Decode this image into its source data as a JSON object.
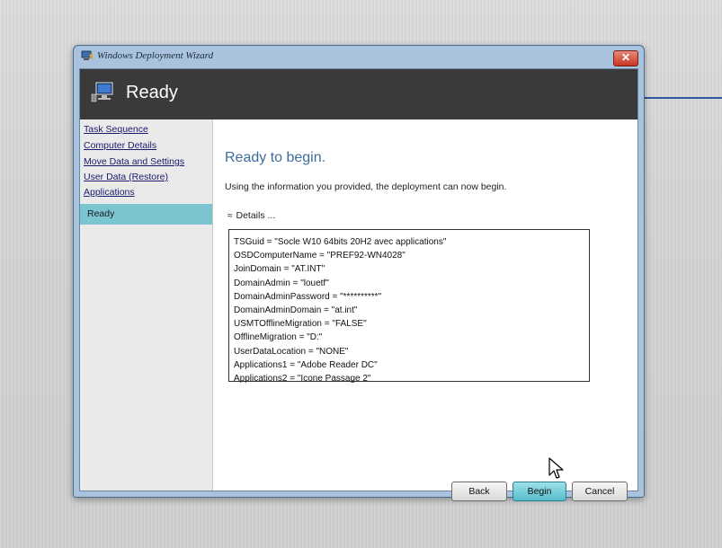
{
  "window": {
    "title": "Windows Deployment Wizard",
    "close_symbol": "✕"
  },
  "header": {
    "title": "Ready",
    "icon": "computer-icon"
  },
  "nav": {
    "items": [
      {
        "label": "Task Sequence",
        "active": false
      },
      {
        "label": "Computer Details",
        "active": false
      },
      {
        "label": "Move Data and Settings",
        "active": false
      },
      {
        "label": "User Data (Restore)",
        "active": false
      },
      {
        "label": "Applications",
        "active": false
      },
      {
        "label": "Ready",
        "active": true
      }
    ]
  },
  "main": {
    "title": "Ready to begin.",
    "description": "Using the information you provided, the deployment can now begin.",
    "details_label": "Details ...",
    "details_chevron": "≈",
    "details": [
      "TSGuid = \"Socle W10 64bits 20H2 avec applications\"",
      "OSDComputerName = \"PREF92-WN4028\"",
      "JoinDomain = \"AT.INT\"",
      "DomainAdmin = \"louetf\"",
      "DomainAdminPassword = \"**********\"",
      "DomainAdminDomain = \"at.int\"",
      "USMTOfflineMigration = \"FALSE\"",
      "OfflineMigration = \"D:\"",
      "UserDataLocation = \"NONE\"",
      "Applications1 = \"Adobe Reader DC\"",
      "Applications2 = \"Icone Passage 2\""
    ]
  },
  "buttons": {
    "back": "Back",
    "begin": "Begin",
    "cancel": "Cancel"
  },
  "colors": {
    "header_bg": "#3a3a3a",
    "active_nav": "#7ac5cf",
    "title_blue": "#3e6c9a",
    "window_frame": "#a9c3de"
  }
}
